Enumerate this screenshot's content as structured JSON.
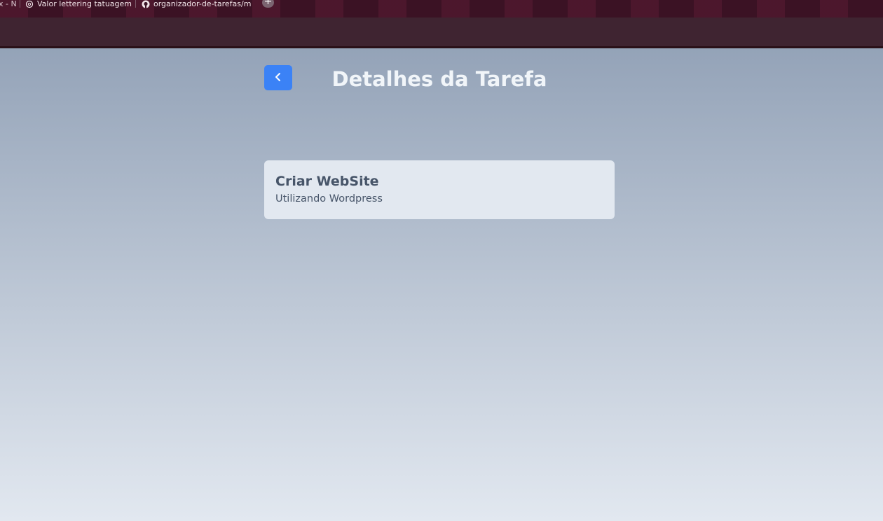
{
  "browser": {
    "tabs": [
      {
        "label": "x - N",
        "icon": "partial-tab"
      },
      {
        "label": "Valor lettering tatuagem",
        "icon": "openai-icon"
      },
      {
        "label": "organizador-de-tarefas/m",
        "icon": "github-icon"
      }
    ],
    "new_tab_label": "+"
  },
  "page": {
    "title": "Detalhes da Tarefa",
    "back_button_icon": "chevron-left-icon",
    "accent_color": "#3b82f6"
  },
  "task": {
    "title": "Criar WebSite",
    "description": "Utilizando Wordpress"
  }
}
